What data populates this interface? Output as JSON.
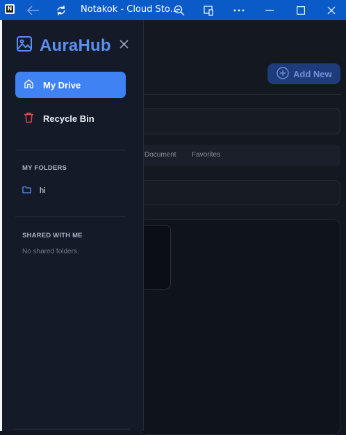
{
  "window": {
    "title": "Notakok - Cloud Sto...",
    "favicon_letter": "N"
  },
  "sidebar": {
    "brand": "AuraHub",
    "nav": [
      {
        "label": "My Drive",
        "icon": "home-icon",
        "active": true
      },
      {
        "label": "Recycle Bin",
        "icon": "trash-icon",
        "active": false
      }
    ],
    "my_folders_title": "MY FOLDERS",
    "folders": [
      {
        "name": "hi",
        "icon": "folder-icon"
      }
    ],
    "shared_title": "SHARED WITH ME",
    "shared_empty": "No shared folders."
  },
  "main": {
    "add_new_label": "Add New",
    "tabs": [
      "Document",
      "Favorites"
    ]
  },
  "colors": {
    "titlebar": "#0a5bc7",
    "accent": "#3f82f3",
    "brand": "#5b8ff0",
    "danger": "#e5484d"
  }
}
